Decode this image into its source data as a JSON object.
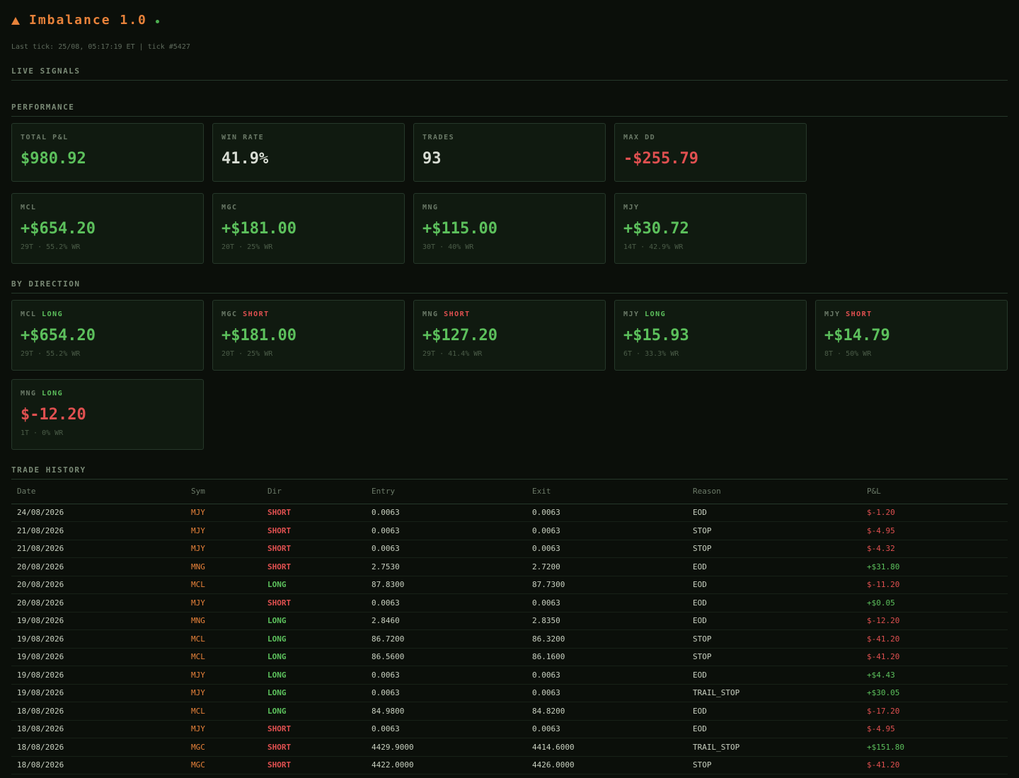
{
  "app": {
    "title": "Imbalance 1.0",
    "last_tick": "Last tick: 25/08, 05:17:19 ET | tick #5427"
  },
  "sections": {
    "live": "LIVE SIGNALS",
    "performance": "PERFORMANCE",
    "by_direction": "BY DIRECTION",
    "trade_history": "TRADE HISTORY"
  },
  "summary": [
    {
      "label": "TOTAL P&L",
      "value": "$980.92",
      "tone": "pos"
    },
    {
      "label": "WIN RATE",
      "value": "41.9%",
      "tone": "neutral"
    },
    {
      "label": "TRADES",
      "value": "93",
      "tone": "neutral"
    },
    {
      "label": "MAX DD",
      "value": "-$255.79",
      "tone": "neg"
    }
  ],
  "by_symbol": [
    {
      "sym": "MCL",
      "value": "+$654.20",
      "sub": "29T · 55.2% WR",
      "tone": "pos"
    },
    {
      "sym": "MGC",
      "value": "+$181.00",
      "sub": "20T · 25% WR",
      "tone": "pos"
    },
    {
      "sym": "MNG",
      "value": "+$115.00",
      "sub": "30T · 40% WR",
      "tone": "pos"
    },
    {
      "sym": "MJY",
      "value": "+$30.72",
      "sub": "14T · 42.9% WR",
      "tone": "pos"
    }
  ],
  "by_direction": [
    {
      "sym": "MCL",
      "dir": "LONG",
      "value": "+$654.20",
      "sub": "29T · 55.2% WR",
      "tone": "pos"
    },
    {
      "sym": "MGC",
      "dir": "SHORT",
      "value": "+$181.00",
      "sub": "20T · 25% WR",
      "tone": "pos"
    },
    {
      "sym": "MNG",
      "dir": "SHORT",
      "value": "+$127.20",
      "sub": "29T · 41.4% WR",
      "tone": "pos"
    },
    {
      "sym": "MJY",
      "dir": "LONG",
      "value": "+$15.93",
      "sub": "6T · 33.3% WR",
      "tone": "pos"
    },
    {
      "sym": "MJY",
      "dir": "SHORT",
      "value": "+$14.79",
      "sub": "8T · 50% WR",
      "tone": "pos"
    },
    {
      "sym": "MNG",
      "dir": "LONG",
      "value": "$-12.20",
      "sub": "1T · 0% WR",
      "tone": "neg"
    }
  ],
  "trades": {
    "columns": [
      "Date",
      "Sym",
      "Dir",
      "Entry",
      "Exit",
      "Reason",
      "P&L"
    ],
    "rows": [
      [
        "24/08/2026",
        "MJY",
        "SHORT",
        "0.0063",
        "0.0063",
        "EOD",
        "$-1.20"
      ],
      [
        "21/08/2026",
        "MJY",
        "SHORT",
        "0.0063",
        "0.0063",
        "STOP",
        "$-4.95"
      ],
      [
        "21/08/2026",
        "MJY",
        "SHORT",
        "0.0063",
        "0.0063",
        "STOP",
        "$-4.32"
      ],
      [
        "20/08/2026",
        "MNG",
        "SHORT",
        "2.7530",
        "2.7200",
        "EOD",
        "+$31.80"
      ],
      [
        "20/08/2026",
        "MCL",
        "LONG",
        "87.8300",
        "87.7300",
        "EOD",
        "$-11.20"
      ],
      [
        "20/08/2026",
        "MJY",
        "SHORT",
        "0.0063",
        "0.0063",
        "EOD",
        "+$0.05"
      ],
      [
        "19/08/2026",
        "MNG",
        "LONG",
        "2.8460",
        "2.8350",
        "EOD",
        "$-12.20"
      ],
      [
        "19/08/2026",
        "MCL",
        "LONG",
        "86.7200",
        "86.3200",
        "STOP",
        "$-41.20"
      ],
      [
        "19/08/2026",
        "MCL",
        "LONG",
        "86.5600",
        "86.1600",
        "STOP",
        "$-41.20"
      ],
      [
        "19/08/2026",
        "MJY",
        "LONG",
        "0.0063",
        "0.0063",
        "EOD",
        "+$4.43"
      ],
      [
        "19/08/2026",
        "MJY",
        "LONG",
        "0.0063",
        "0.0063",
        "TRAIL_STOP",
        "+$30.05"
      ],
      [
        "18/08/2026",
        "MCL",
        "LONG",
        "84.9800",
        "84.8200",
        "EOD",
        "$-17.20"
      ],
      [
        "18/08/2026",
        "MJY",
        "SHORT",
        "0.0063",
        "0.0063",
        "EOD",
        "$-4.95"
      ],
      [
        "18/08/2026",
        "MGC",
        "SHORT",
        "4429.9000",
        "4414.6000",
        "TRAIL_STOP",
        "+$151.80"
      ],
      [
        "18/08/2026",
        "MGC",
        "SHORT",
        "4422.0000",
        "4426.0000",
        "STOP",
        "$-41.20"
      ]
    ]
  },
  "colors": {
    "accent": "#e8823a",
    "positive": "#5cc05c",
    "negative": "#e05050",
    "background": "#0b0f0a"
  }
}
